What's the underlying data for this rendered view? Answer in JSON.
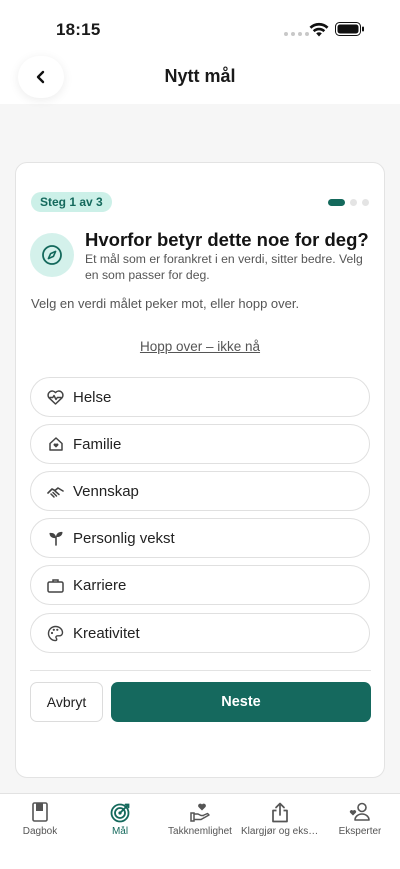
{
  "status_bar": {
    "time": "18:15"
  },
  "nav": {
    "title": "Nytt mål"
  },
  "step": {
    "badge": "Steg 1 av 3",
    "current": 1,
    "total": 3
  },
  "header": {
    "title": "Hvorfor betyr dette noe for deg?",
    "subtitle": "Et mål som er forankret i en verdi, sitter bedre. Velg en som passer for deg.",
    "icon": "compass-icon"
  },
  "prompt": "Velg en verdi målet peker mot, eller hopp over.",
  "skip_label": "Hopp over – ikke nå",
  "options": [
    {
      "label": "Helse",
      "icon": "heart-pulse-icon"
    },
    {
      "label": "Familie",
      "icon": "home-heart-icon"
    },
    {
      "label": "Vennskap",
      "icon": "handshake-icon"
    },
    {
      "label": "Personlig vekst",
      "icon": "sprout-icon"
    },
    {
      "label": "Karriere",
      "icon": "briefcase-icon"
    },
    {
      "label": "Kreativitet",
      "icon": "palette-icon"
    }
  ],
  "buttons": {
    "cancel": "Avbryt",
    "next": "Neste"
  },
  "tabs": [
    {
      "label": "Dagbok",
      "icon": "journal-icon",
      "active": false
    },
    {
      "label": "Mål",
      "icon": "target-icon",
      "active": true
    },
    {
      "label": "Takknemlighet",
      "icon": "gratitude-hand-icon",
      "active": false
    },
    {
      "label": "Klargjør og ekspert",
      "icon": "share-icon",
      "active": false
    },
    {
      "label": "Eksperter",
      "icon": "experts-icon",
      "active": false
    }
  ],
  "colors": {
    "accent": "#15695E",
    "accent_light": "#CCF0E8",
    "background": "#F6F6F6"
  }
}
